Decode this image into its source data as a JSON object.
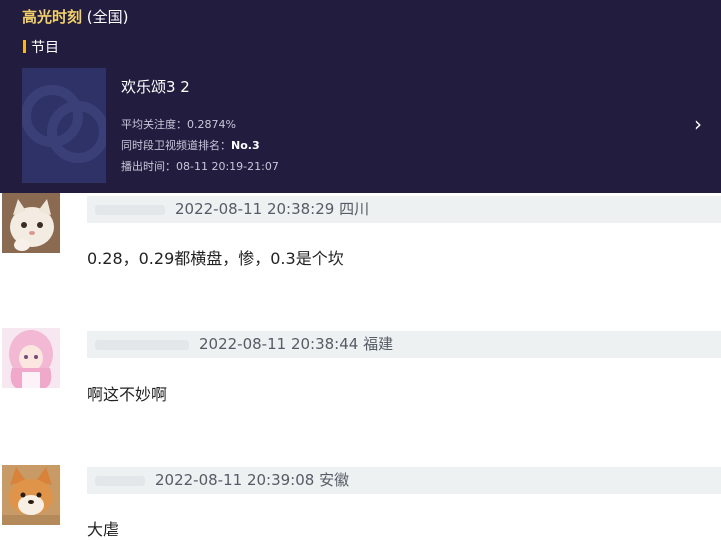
{
  "header": {
    "title_highlight": "高光时刻",
    "title_scope": "(全国)",
    "section_label": "节目",
    "program": {
      "name": "欢乐颂3 2",
      "attention_label": "平均关注度：",
      "attention_value": "0.2874%",
      "rank_label": "同时段卫视频道排名：",
      "rank_value": "No.3",
      "airtime_label": "播出时间：",
      "airtime_value": "08-11 20:19-21:07"
    },
    "chevron": "›"
  },
  "comments": [
    {
      "avatar": "cat-avatar",
      "time": "2022-08-11 20:38:29",
      "region": "四川",
      "text": "0.28，0.29都横盘，惨，0.3是个坎"
    },
    {
      "avatar": "anime-girl-avatar",
      "time": "2022-08-11 20:38:44",
      "region": "福建",
      "text": "啊这不妙啊"
    },
    {
      "avatar": "dog-avatar",
      "time": "2022-08-11 20:39:08",
      "region": "安徽",
      "text": "大虐"
    }
  ]
}
